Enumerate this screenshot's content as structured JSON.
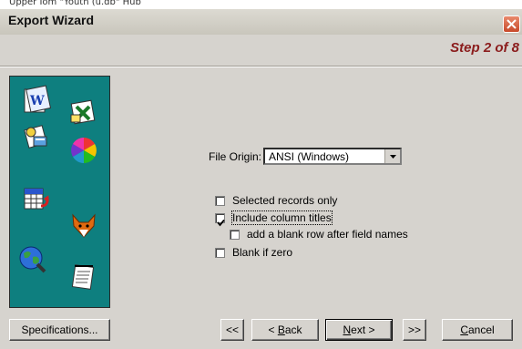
{
  "background_window": {
    "title_fragment": "Upper Iom \"Youth (u.db\" Hub"
  },
  "window": {
    "title": "Export Wizard",
    "step": "Step 2 of 8"
  },
  "sidebar": {
    "icons": [
      "word-document-icon",
      "excel-spreadsheet-icon",
      "database-forms-icon",
      "color-wheel-icon",
      "table-export-icon",
      "foxpro-fox-icon",
      "globe-search-icon",
      "notepad-icon"
    ]
  },
  "file_origin": {
    "label": "File Origin:",
    "value": "ANSI (Windows)"
  },
  "options": [
    {
      "label": "Selected records only",
      "checked": false
    },
    {
      "label": "Include column titles",
      "checked": true
    },
    {
      "label": "add a blank row after field names",
      "checked": false
    },
    {
      "label": "Blank if zero",
      "checked": false
    }
  ],
  "buttons": {
    "specifications": "Specifications...",
    "first": "<<",
    "back": "< Back",
    "back_key": "B",
    "back_pre": "< ",
    "back_post": "ack",
    "next": "Next >",
    "next_key": "N",
    "next_post": "ext >",
    "last": ">>",
    "cancel": "Cancel",
    "cancel_key": "C",
    "cancel_post": "ancel"
  },
  "colors": {
    "sidebar_bg": "#0e7f7f",
    "step_text": "#8b1d1d",
    "dialog_bg": "#d6d3ce"
  }
}
